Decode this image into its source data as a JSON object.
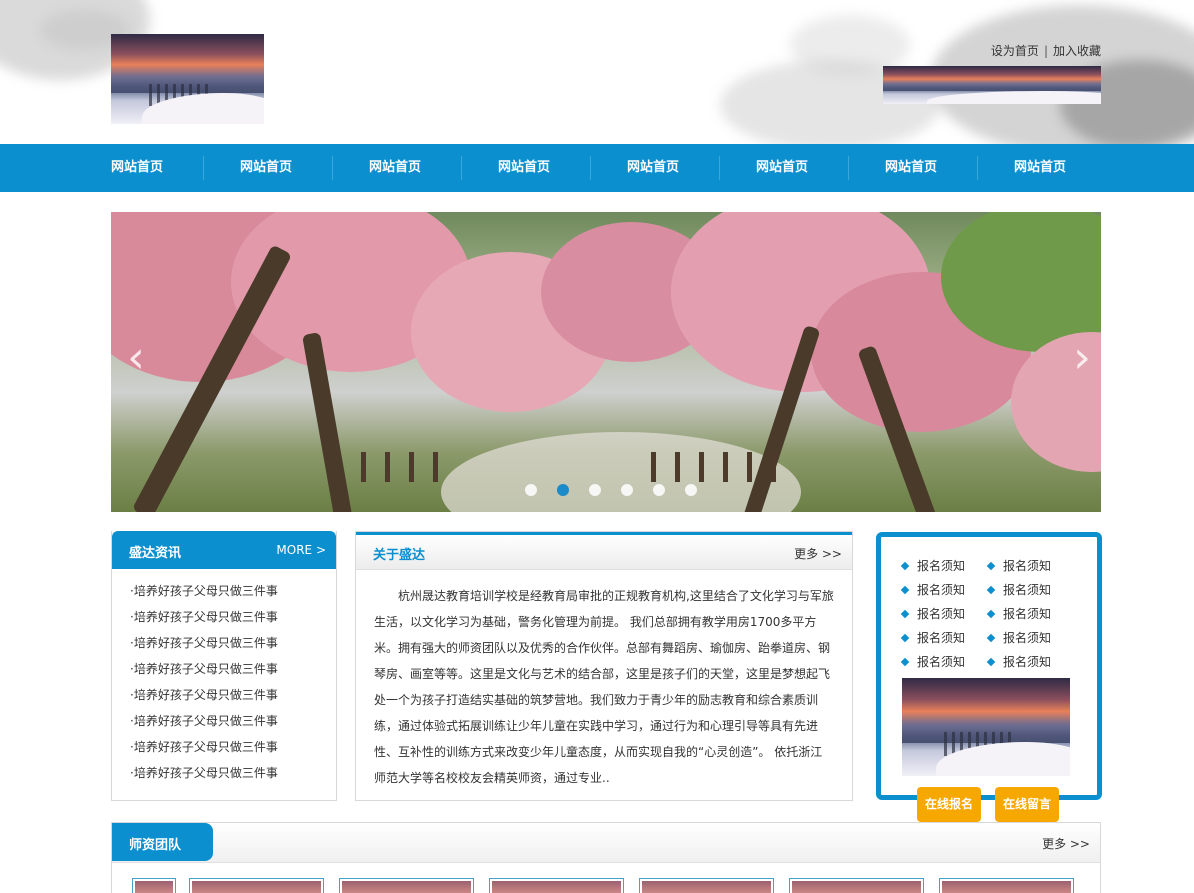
{
  "header": {
    "links": [
      "设为首页",
      "加入收藏"
    ],
    "link_separator": "|"
  },
  "nav": {
    "items": [
      "网站首页",
      "网站首页",
      "网站首页",
      "网站首页",
      "网站首页",
      "网站首页",
      "网站首页",
      "网站首页"
    ]
  },
  "slider": {
    "slide_count": 6,
    "active_index": 1,
    "prev_glyph": "‹",
    "next_glyph": "›"
  },
  "news": {
    "title": "盛达资讯",
    "more": "MORE >",
    "items": [
      "·培养好孩子父母只做三件事",
      "·培养好孩子父母只做三件事",
      "·培养好孩子父母只做三件事",
      "·培养好孩子父母只做三件事",
      "·培养好孩子父母只做三件事",
      "·培养好孩子父母只做三件事",
      "·培养好孩子父母只做三件事",
      "·培养好孩子父母只做三件事"
    ]
  },
  "about": {
    "title": "关于盛达",
    "more": "更多 >>",
    "text": "杭州晟达教育培训学校是经教育局审批的正规教育机构,这里结合了文化学习与军旅生活，以文化学习为基础，警务化管理为前提。 我们总部拥有教学用房1700多平方米。拥有强大的师资团队以及优秀的合作伙伴。总部有舞蹈房、瑜伽房、跆拳道房、钢琴房、画室等等。这里是文化与艺术的结合部，这里是孩子们的天堂，这里是梦想起飞处一个为孩子打造结实基础的筑梦营地。我们致力于青少年的励志教育和综合素质训练，通过体验式拓展训练让少年儿童在实践中学习，通过行为和心理引导等具有先进性、互补性的训练方式来改变少年儿童态度，从而实现自我的“心灵创造”。 依托浙江师范大学等名校校友会精英师资，通过专业.."
  },
  "notice": {
    "items": [
      "报名须知",
      "报名须知",
      "报名须知",
      "报名须知",
      "报名须知",
      "报名须知",
      "报名须知",
      "报名须知",
      "报名须知",
      "报名须知"
    ],
    "buttons": [
      "在线报名",
      "在线留言"
    ]
  },
  "team": {
    "title": "师资团队",
    "more": "更多 >>"
  },
  "colors": {
    "accent": "#0b8fcf",
    "button": "#f6a800"
  }
}
